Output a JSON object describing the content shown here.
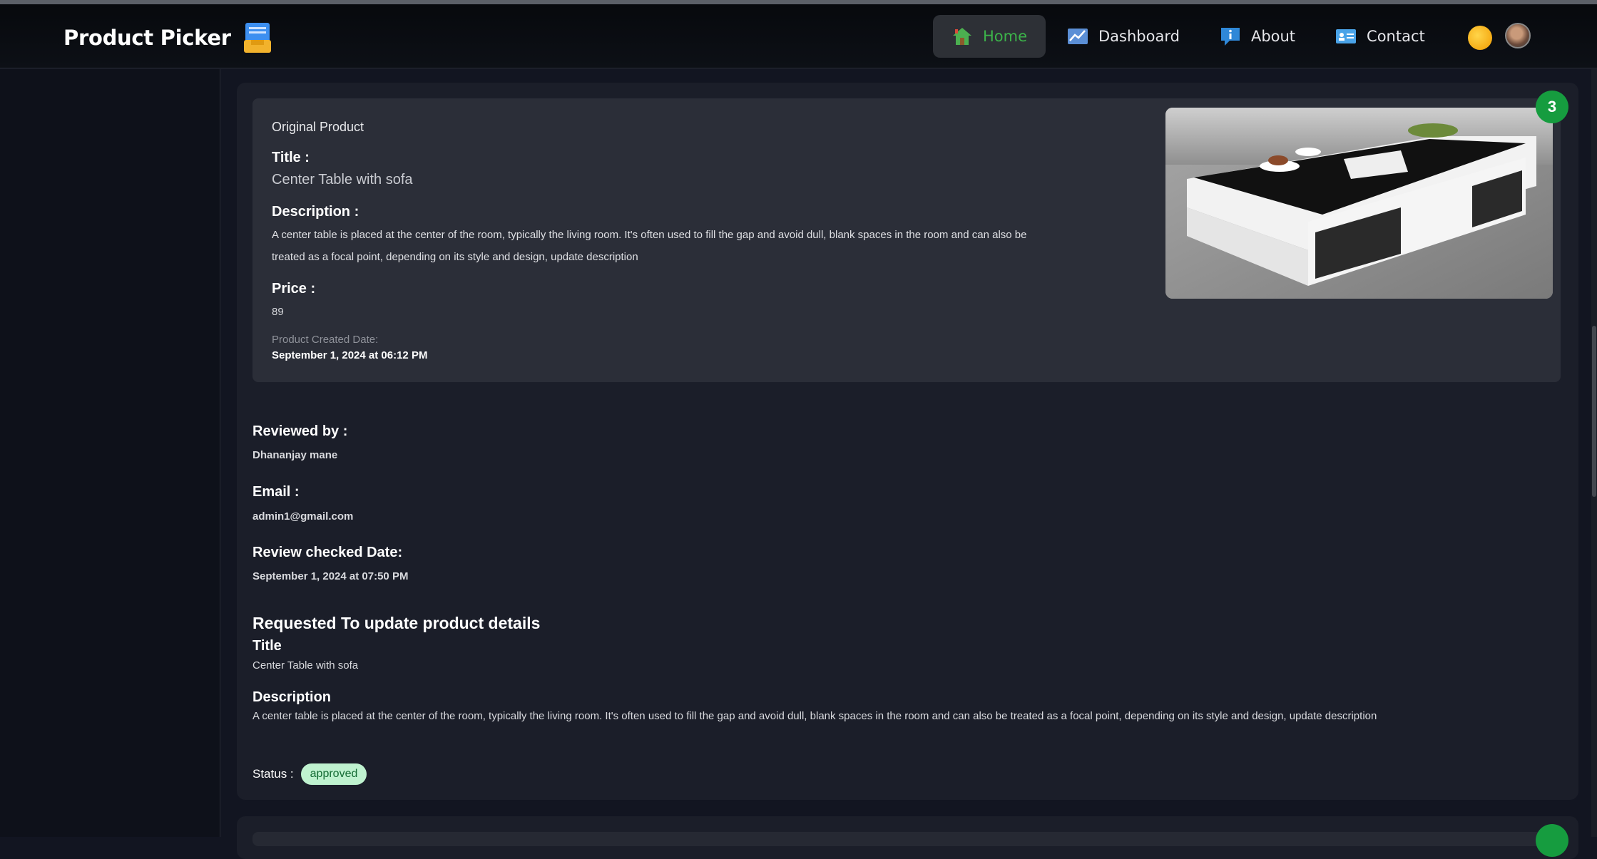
{
  "brand": {
    "title": "Product Picker",
    "icon": "inbox-tray-icon"
  },
  "nav": {
    "items": [
      {
        "label": "Home",
        "icon": "house-icon",
        "active": true
      },
      {
        "label": "Dashboard",
        "icon": "chart-icon",
        "active": false
      },
      {
        "label": "About",
        "icon": "info-icon",
        "active": false
      },
      {
        "label": "Contact",
        "icon": "id-card-icon",
        "active": false
      }
    ],
    "theme_icon": "sun-icon",
    "avatar": "user-avatar"
  },
  "card": {
    "badge": "3",
    "original": {
      "heading": "Original Product",
      "title_label": "Title :",
      "title_value": "Center Table with sofa",
      "description_label": "Description :",
      "description_value": "A center table is placed at the center of the room, typically the living room. It's often used to fill the gap and avoid dull, blank spaces in the room and can also be treated as a focal point, depending on its style and design, update description",
      "price_label": "Price :",
      "price_value": "89",
      "created_label": "Product Created Date:",
      "created_value": "September 1, 2024 at 06:12 PM"
    },
    "reviewed_by_label": "Reviewed by :",
    "reviewed_by_value": "Dhananjay mane",
    "email_label": "Email :",
    "email_value": "admin1@gmail.com",
    "review_date_label": "Review checked Date:",
    "review_date_value": "September 1, 2024 at 07:50 PM",
    "request": {
      "heading": "Requested To update product details",
      "title_label": "Title",
      "title_value": "Center Table with sofa",
      "description_label": "Description",
      "description_value": "A center table is placed at the center of the room, typically the living room. It's often used to fill the gap and avoid dull, blank spaces in the room and can also be treated as a focal point, depending on its style and design, update description"
    },
    "status_label": "Status :",
    "status_value": "approved"
  },
  "colors": {
    "active_nav": "#3cb34a",
    "badge": "#169c3f",
    "status_pill": "#bff2cf"
  }
}
